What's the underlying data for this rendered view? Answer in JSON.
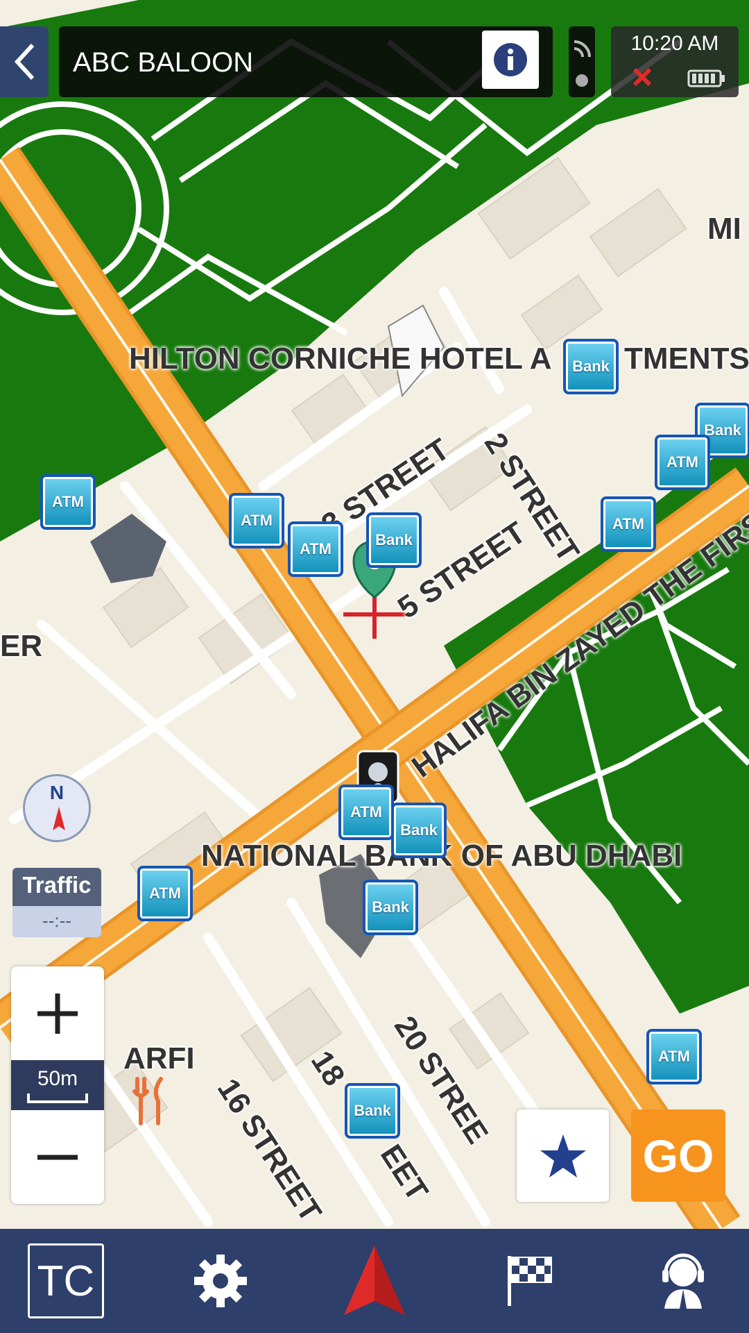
{
  "header": {
    "title": "ABC BALOON",
    "time": "10:20 AM"
  },
  "map": {
    "labels": {
      "hilton": "HILTON CORNICHE HOTEL A",
      "hilton_tail": "TMENTS",
      "street3": "3 STREET",
      "street2": "2 STREET",
      "street5": "5 STREET",
      "khalifa": "HALIFA BIN ZAYED THE FIRST",
      "national_bank": "NATIONAL BANK OF ABU DHABI",
      "street20": "20 STREE",
      "street18": "18",
      "street18_tail": "EET",
      "street16": "16 STREET",
      "arfi": "ARFI",
      "er": "ER",
      "mi": "MI"
    },
    "poi_atm": "ATM",
    "poi_bank": "Bank",
    "compass": "N"
  },
  "traffic": {
    "label": "Traffic",
    "value": "--:--"
  },
  "zoom": {
    "scale": "50m"
  },
  "go_button": "GO",
  "bottom_nav": {
    "tc_label": "TC"
  },
  "colors": {
    "park": "#187a0e",
    "land": "#f3efe3",
    "road_major": "#f6a73a",
    "nav_bar": "#2d3f6a",
    "go": "#f7941e",
    "accent_red": "#e02a2a"
  }
}
